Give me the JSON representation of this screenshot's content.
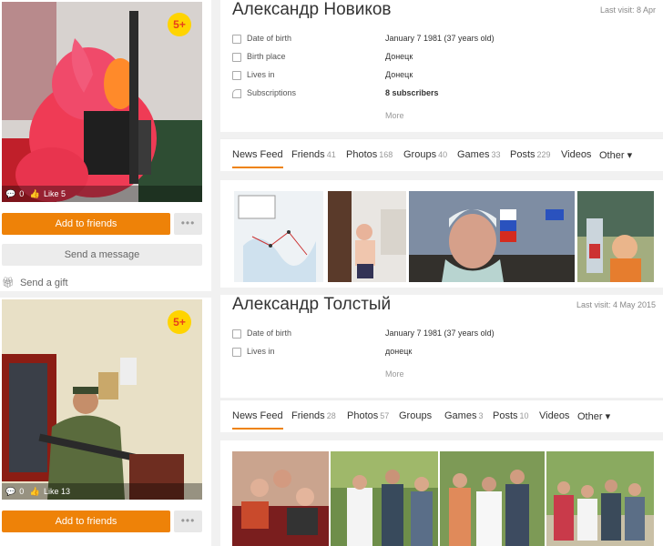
{
  "profiles": [
    {
      "badge": "5+",
      "likes_bar": {
        "comments": "0",
        "likes": "Like 5"
      },
      "buttons": {
        "add_friends": "Add to friends",
        "more": "•••",
        "message": "Send a message",
        "gift": "Send a gift"
      },
      "name": "Александр Новиков",
      "last_visit": "Last visit: 8 Apr",
      "info": [
        {
          "label": "Date of birth",
          "value": "January 7 1981 (37 years old)",
          "bold": false,
          "icon": "calendar-icon"
        },
        {
          "label": "Birth place",
          "value": "Донецк",
          "bold": false,
          "icon": "city-icon"
        },
        {
          "label": "Lives in",
          "value": "Донецк",
          "bold": false,
          "icon": "city-icon"
        },
        {
          "label": "Subscriptions",
          "value": "8 subscribers",
          "bold": true,
          "icon": "rss-icon"
        }
      ],
      "more": "More",
      "tabs": [
        {
          "label": "News Feed",
          "count": ""
        },
        {
          "label": "Friends",
          "count": "41"
        },
        {
          "label": "Photos",
          "count": "168"
        },
        {
          "label": "Groups",
          "count": "40"
        },
        {
          "label": "Games",
          "count": "33"
        },
        {
          "label": "Posts",
          "count": "229"
        },
        {
          "label": "Videos",
          "count": ""
        },
        {
          "label": "Other ▾",
          "count": ""
        }
      ]
    },
    {
      "badge": "5+",
      "likes_bar": {
        "comments": "0",
        "likes": "Like 13"
      },
      "buttons": {
        "add_friends": "Add to friends",
        "more": "•••"
      },
      "name": "Александр Толстый",
      "last_visit": "Last visit: 4 May 2015",
      "info": [
        {
          "label": "Date of birth",
          "value": "January 7 1981 (37 years old)",
          "bold": false,
          "icon": "calendar-icon"
        },
        {
          "label": "Lives in",
          "value": "донецк",
          "bold": false,
          "icon": "city-icon"
        }
      ],
      "more": "More",
      "tabs": [
        {
          "label": "News Feed",
          "count": ""
        },
        {
          "label": "Friends",
          "count": "28"
        },
        {
          "label": "Photos",
          "count": "57"
        },
        {
          "label": "Groups",
          "count": ""
        },
        {
          "label": "Games",
          "count": "3"
        },
        {
          "label": "Posts",
          "count": "10"
        },
        {
          "label": "Videos",
          "count": ""
        },
        {
          "label": "Other ▾",
          "count": ""
        }
      ]
    }
  ],
  "colors": {
    "accent": "#ee8208",
    "badge": "#ffd400"
  }
}
